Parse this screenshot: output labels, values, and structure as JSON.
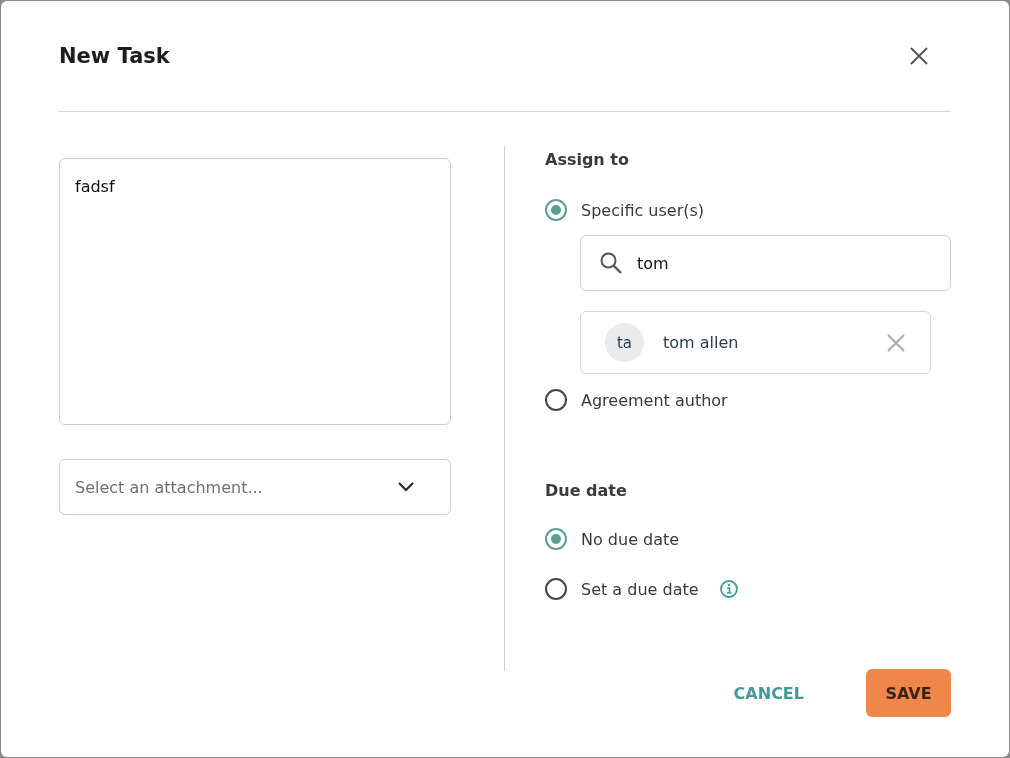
{
  "dialog": {
    "title": "New Task"
  },
  "description": {
    "value": "fadsf"
  },
  "attachment": {
    "placeholder": "Select an attachment..."
  },
  "assign": {
    "heading": "Assign to",
    "options": [
      {
        "label": "Specific user(s)",
        "selected": true
      },
      {
        "label": "Agreement author",
        "selected": false
      }
    ],
    "search": {
      "value": "tom"
    },
    "users": [
      {
        "initials": "ta",
        "name": "tom allen"
      }
    ]
  },
  "due": {
    "heading": "Due date",
    "options": [
      {
        "label": "No due date",
        "selected": true,
        "info": false
      },
      {
        "label": "Set a due date",
        "selected": false,
        "info": true
      }
    ]
  },
  "buttons": [
    {
      "label": "CANCEL",
      "kind": "text"
    },
    {
      "label": "SAVE",
      "kind": "primary"
    }
  ]
}
